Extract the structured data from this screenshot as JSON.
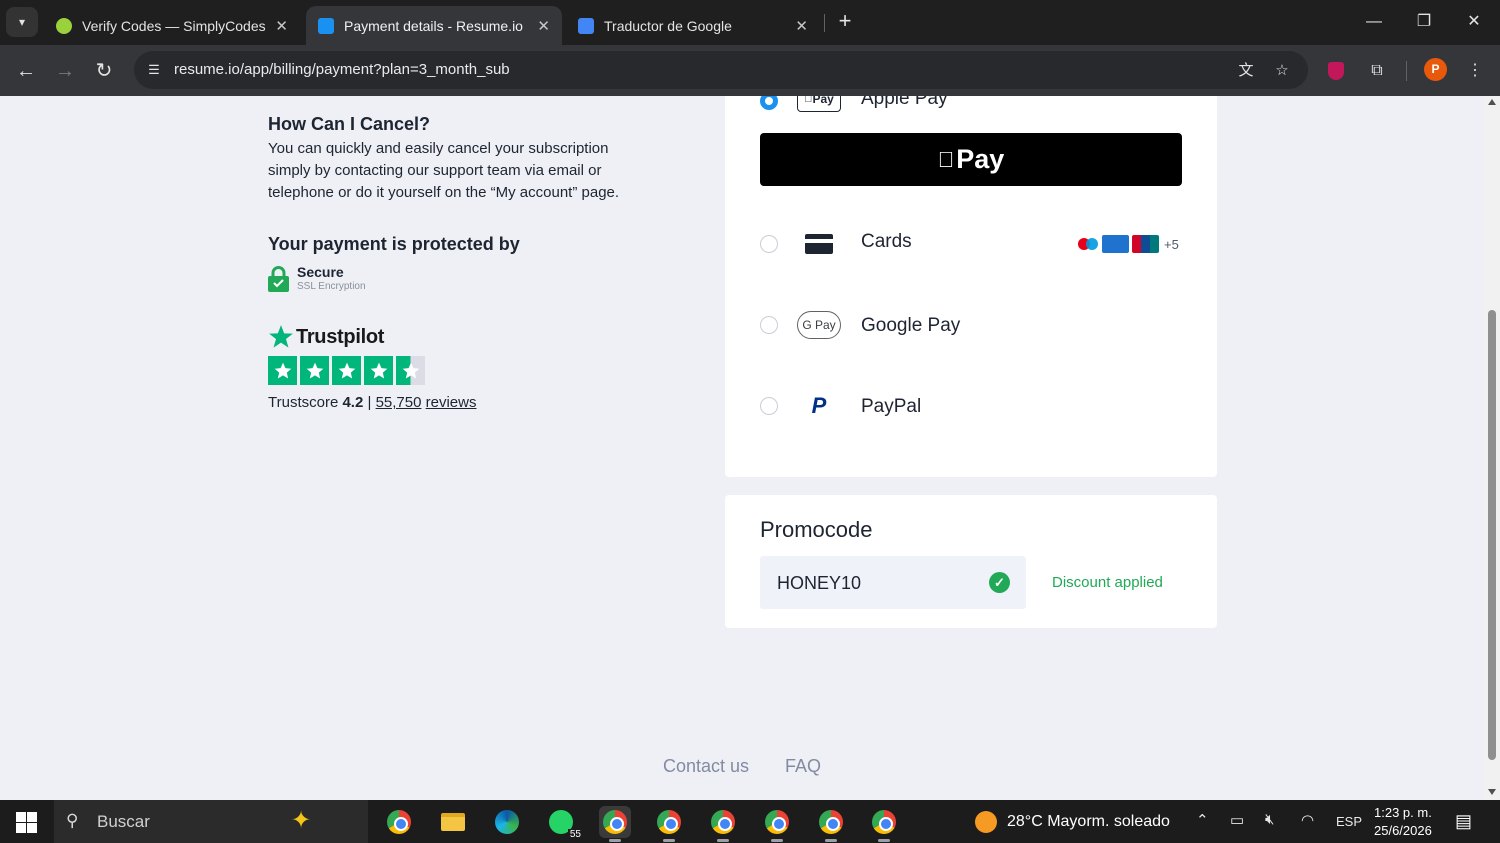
{
  "browser": {
    "tabs": [
      {
        "title": "Verify Codes — SimplyCodes",
        "active": false,
        "favicon": "simplycodes-icon"
      },
      {
        "title": "Payment details - Resume.io",
        "active": true,
        "favicon": "resume-io-icon"
      },
      {
        "title": "Traductor de Google",
        "active": false,
        "favicon": "google-translate-icon"
      }
    ],
    "url": "resume.io/app/billing/payment?plan=3_month_sub",
    "profile_initial": "P"
  },
  "left": {
    "cancel_heading": "How Can I Cancel?",
    "cancel_text": "You can quickly and easily cancel your subscription simply by contacting our support team via email or telephone or do it yourself on the “My account” page.",
    "protect_heading": "Your payment is protected by",
    "secure_title": "Secure",
    "secure_subtitle": "SSL Encryption",
    "trustpilot_name": "Trustpilot",
    "trustscore_label": "Trustscore",
    "trustscore_value": "4.2",
    "separator": "|",
    "review_count": "55,750",
    "reviews_label": "reviews",
    "rating_stars": 4.5
  },
  "payment": {
    "methods": [
      {
        "label": "Apple Pay",
        "selected": true,
        "logo_text": "Pay"
      },
      {
        "label": "Cards",
        "selected": false
      },
      {
        "label": "Google Pay",
        "selected": false,
        "logo_text": "G Pay"
      },
      {
        "label": "PayPal",
        "selected": false,
        "logo_text": "P"
      }
    ],
    "apple_pay_button": "Pay",
    "cards_more": "+5",
    "card_brands": [
      "maestro",
      "amex",
      "unionpay"
    ]
  },
  "promo": {
    "title": "Promocode",
    "value": "HONEY10",
    "status": "Discount applied"
  },
  "footer": {
    "contact": "Contact us",
    "faq": "FAQ"
  },
  "taskbar": {
    "search_placeholder": "Buscar",
    "whatsapp_badge": "55",
    "weather": "28°C  Mayorm. soleado",
    "language": "ESP",
    "time": "1:23 p. m.",
    "date": "25/6/2026"
  },
  "colors": {
    "accent_blue": "#1a91f0",
    "success_green": "#21a957",
    "trustpilot_green": "#00b67a"
  }
}
